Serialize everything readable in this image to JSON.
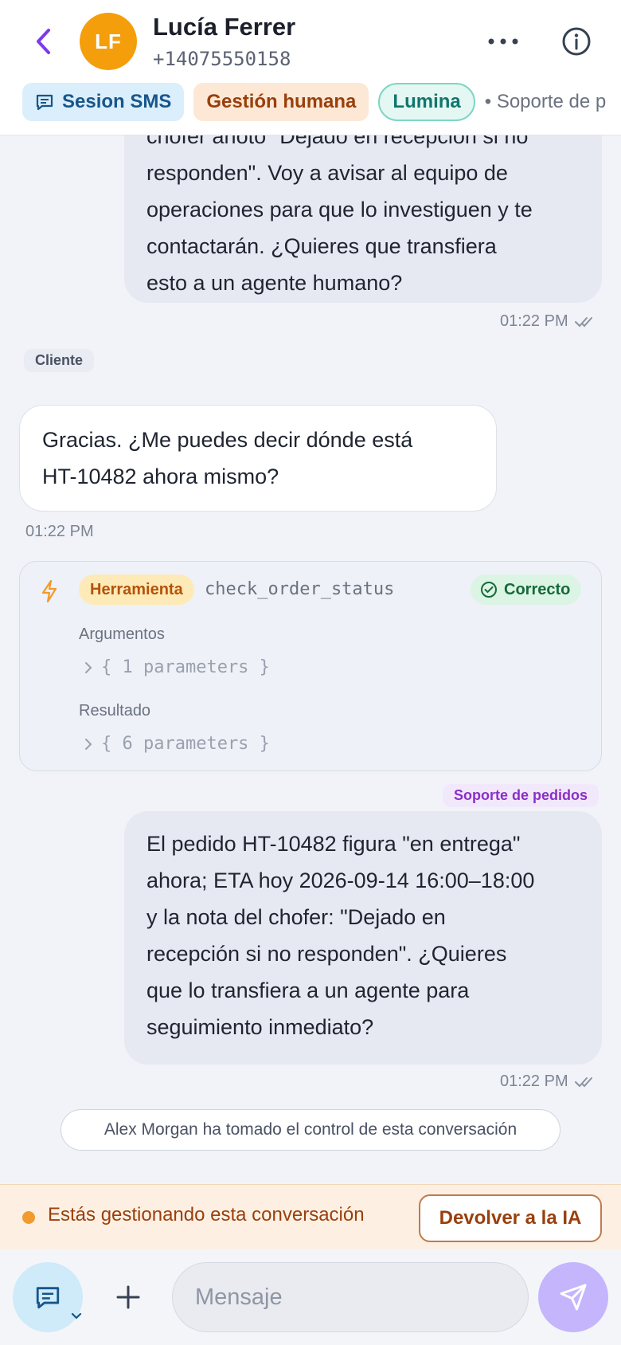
{
  "header": {
    "contact_initials": "LF",
    "contact_name": "Lucía Ferrer",
    "contact_phone": "+14075550158",
    "tags": {
      "sms": "Sesion SMS",
      "human": "Gestión humana",
      "agent": "Lumina",
      "extra": "• Soporte de p"
    }
  },
  "messages": {
    "m1": {
      "lines": [
        "chofer anotó \"Dejado en recepción si no",
        "responden\". Voy a avisar al equipo de",
        "operaciones para que lo investiguen y te",
        "contactarán. ¿Quieres que transfiera",
        "esto a un agente humano?"
      ],
      "time": "01:22 PM"
    },
    "m2": {
      "role": "Cliente",
      "lines": [
        "Gracias. ¿Me puedes decir dónde está",
        "HT-10482 ahora mismo?"
      ],
      "time": "01:22 PM"
    },
    "tool": {
      "badge": "Herramienta",
      "name": "check_order_status",
      "status": "Correcto",
      "args_label": "Argumentos",
      "args_value": "{ 1 parameters }",
      "result_label": "Resultado",
      "result_value": "{ 6 parameters }"
    },
    "m3": {
      "role": "Soporte de pedidos",
      "lines": [
        "El pedido HT-10482 figura \"en entrega\"",
        "ahora; ETA hoy 2026-09-14 16:00–18:00",
        "y la nota del chofer: \"Dejado en",
        "recepción si no responden\". ¿Quieres",
        "que lo transfiera a un agente para",
        "seguimiento inmediato?"
      ],
      "time": "01:22 PM"
    },
    "system_note": "Alex Morgan ha tomado el control de esta conversación"
  },
  "handoff": {
    "text": "Estás gestionando esta conversación",
    "return_label": "Devolver a la IA"
  },
  "composer": {
    "placeholder": "Mensaje"
  },
  "colors": {
    "accent": "#7c3aed",
    "avatar": "#f59e0b",
    "send": "#c4b5fd"
  }
}
